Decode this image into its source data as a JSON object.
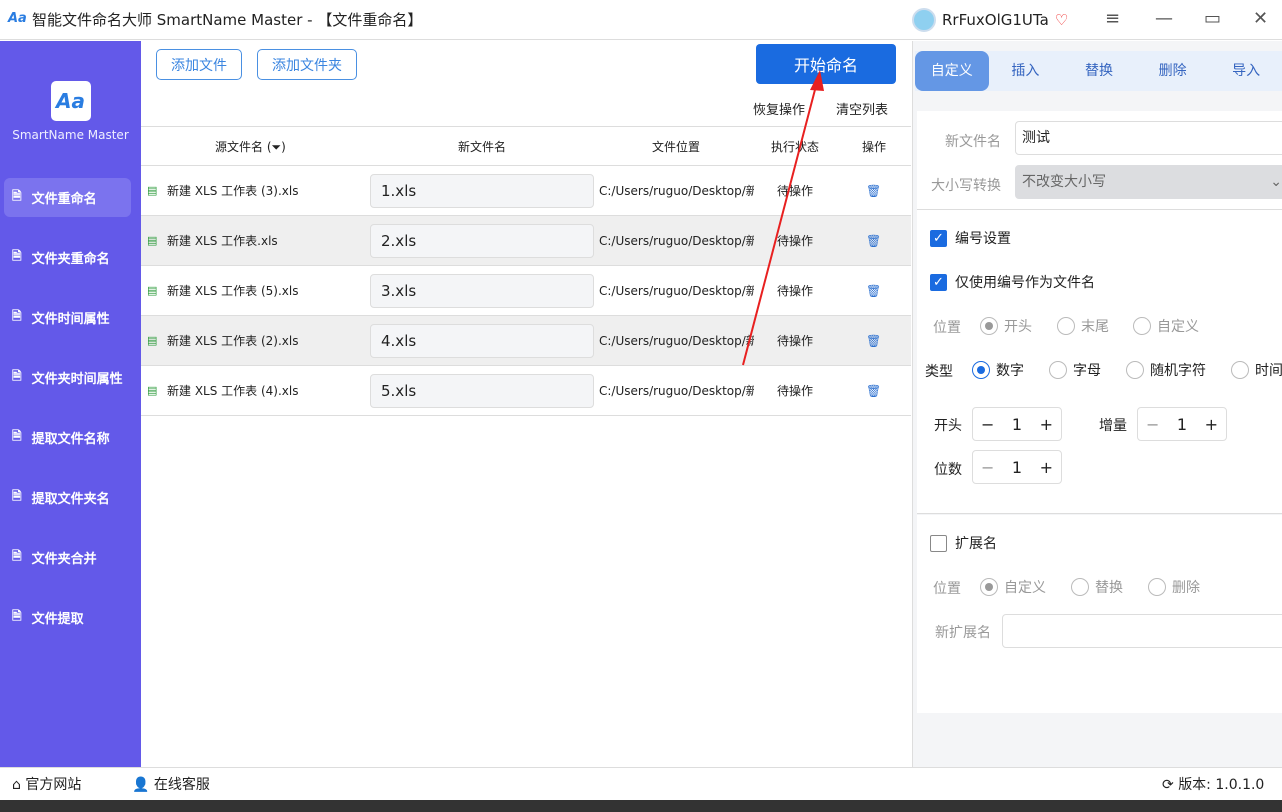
{
  "titlebar": {
    "title": "智能文件命名大师 SmartName Master - 【文件重命名】",
    "username": "RrFuxOlG1UTa"
  },
  "sidebar": {
    "app_name": "SmartName Master",
    "items": [
      {
        "label": "文件重命名"
      },
      {
        "label": "文件夹重命名"
      },
      {
        "label": "文件时间属性"
      },
      {
        "label": "文件夹时间属性"
      },
      {
        "label": "提取文件名称"
      },
      {
        "label": "提取文件夹名"
      },
      {
        "label": "文件夹合并"
      },
      {
        "label": "文件提取"
      }
    ]
  },
  "toolbar": {
    "add_file": "添加文件",
    "add_folder": "添加文件夹",
    "start": "开始命名",
    "restore": "恢复操作",
    "clear": "清空列表"
  },
  "table": {
    "headers": [
      "源文件名 (⏷)",
      "新文件名",
      "文件位置",
      "执行状态",
      "操作"
    ],
    "rows": [
      {
        "src": "新建 XLS 工作表 (3).xls",
        "new": "1.xls",
        "path": "C:/Users/ruguo/Desktop/新",
        "status": "待操作"
      },
      {
        "src": "新建 XLS 工作表.xls",
        "new": "2.xls",
        "path": "C:/Users/ruguo/Desktop/新",
        "status": "待操作"
      },
      {
        "src": "新建 XLS 工作表 (5).xls",
        "new": "3.xls",
        "path": "C:/Users/ruguo/Desktop/新",
        "status": "待操作"
      },
      {
        "src": "新建 XLS 工作表 (2).xls",
        "new": "4.xls",
        "path": "C:/Users/ruguo/Desktop/新",
        "status": "待操作"
      },
      {
        "src": "新建 XLS 工作表 (4).xls",
        "new": "5.xls",
        "path": "C:/Users/ruguo/Desktop/新",
        "status": "待操作"
      }
    ]
  },
  "panel": {
    "tabs": [
      "自定义",
      "插入",
      "替换",
      "删除",
      "导入"
    ],
    "new_name_label": "新文件名",
    "new_name_value": "测试",
    "case_label": "大小写转换",
    "case_value": "不改变大小写",
    "numbering": "编号设置",
    "only_number": "仅使用编号作为文件名",
    "position_label": "位置",
    "positions": [
      "开头",
      "末尾",
      "自定义"
    ],
    "type_label": "类型",
    "types": [
      "数字",
      "字母",
      "随机字符",
      "时间"
    ],
    "start_label": "开头",
    "start_value": "1",
    "increment_label": "增量",
    "increment_value": "1",
    "digits_label": "位数",
    "digits_value": "1",
    "ext_label": "扩展名",
    "ext_position_label": "位置",
    "ext_positions": [
      "自定义",
      "替换",
      "删除"
    ],
    "new_ext_label": "新扩展名"
  },
  "footer": {
    "website": "官方网站",
    "support": "在线客服",
    "version": "版本: 1.0.1.0"
  }
}
